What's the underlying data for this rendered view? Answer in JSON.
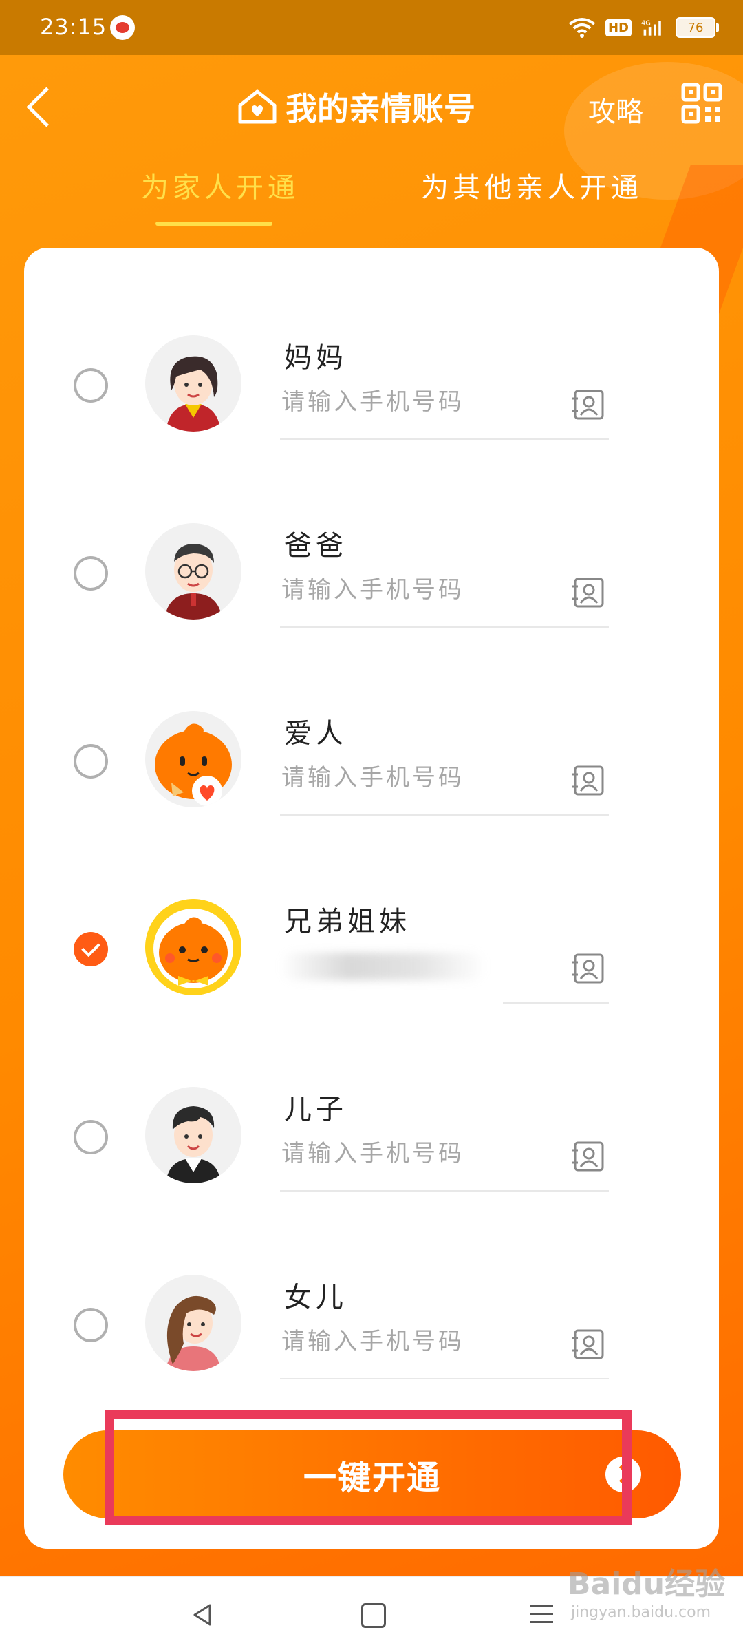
{
  "status_bar": {
    "time": "23:15",
    "network": "4G",
    "hd": "HD",
    "battery": "76"
  },
  "header": {
    "title": "我的亲情账号",
    "strategy_link": "攻略",
    "tabs": [
      {
        "label": "为家人开通",
        "active": true
      },
      {
        "label": "为其他亲人开通",
        "active": false
      }
    ]
  },
  "members": [
    {
      "role": "妈妈",
      "placeholder": "请输入手机号码",
      "checked": false
    },
    {
      "role": "爸爸",
      "placeholder": "请输入手机号码",
      "checked": false
    },
    {
      "role": "爱人",
      "placeholder": "请输入手机号码",
      "checked": false
    },
    {
      "role": "兄弟姐妹",
      "placeholder": "",
      "checked": true
    },
    {
      "role": "儿子",
      "placeholder": "请输入手机号码",
      "checked": false
    },
    {
      "role": "女儿",
      "placeholder": "请输入手机号码",
      "checked": false
    }
  ],
  "action": {
    "open_button": "一键开通"
  },
  "watermark": {
    "brand": "Baidu经验",
    "url": "jingyan.baidu.com"
  },
  "colors": {
    "accent": "#ff8a00",
    "checked": "#ff5b14",
    "tab_active": "#ffe04a",
    "highlight": "#ea3a5a"
  }
}
